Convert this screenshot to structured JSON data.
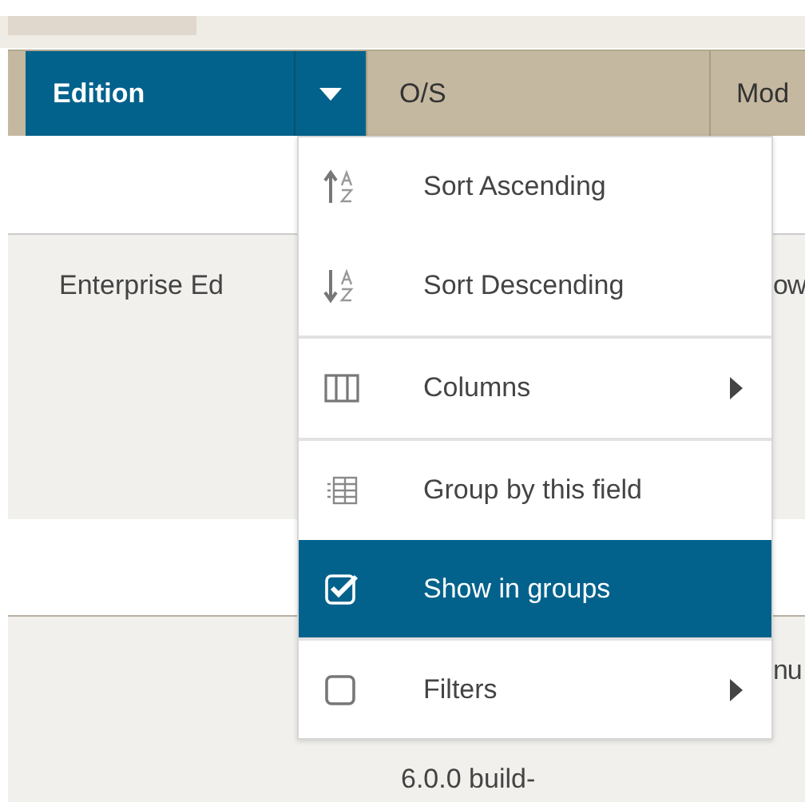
{
  "table": {
    "columns": [
      {
        "label": "Edition",
        "selected": true
      },
      {
        "label": "O/S",
        "selected": false
      },
      {
        "label": "Mod",
        "selected": false
      }
    ],
    "rows": [
      {
        "cells": [
          null,
          null,
          null
        ]
      },
      {
        "cells": [
          "Enterprise Ed",
          null,
          "ow"
        ]
      },
      {
        "cells": [
          null,
          null,
          null
        ]
      },
      {
        "cells": [
          null,
          "6.0.0 build-",
          "nu"
        ]
      }
    ]
  },
  "column_menu": {
    "sections": [
      [
        {
          "kind": "sort-ascending",
          "label": "Sort Ascending",
          "selected": false
        },
        {
          "kind": "sort-descending",
          "label": "Sort Descending",
          "selected": false
        }
      ],
      [
        {
          "kind": "columns",
          "label": "Columns",
          "submenu": true,
          "selected": false
        }
      ],
      [
        {
          "kind": "group",
          "label": "Group by this field",
          "selected": false
        },
        {
          "kind": "checkbox",
          "label": "Show in groups",
          "checked": true,
          "selected": true
        }
      ],
      [
        {
          "kind": "checkbox",
          "label": "Filters",
          "checked": false,
          "submenu": true,
          "selected": false
        }
      ]
    ]
  }
}
